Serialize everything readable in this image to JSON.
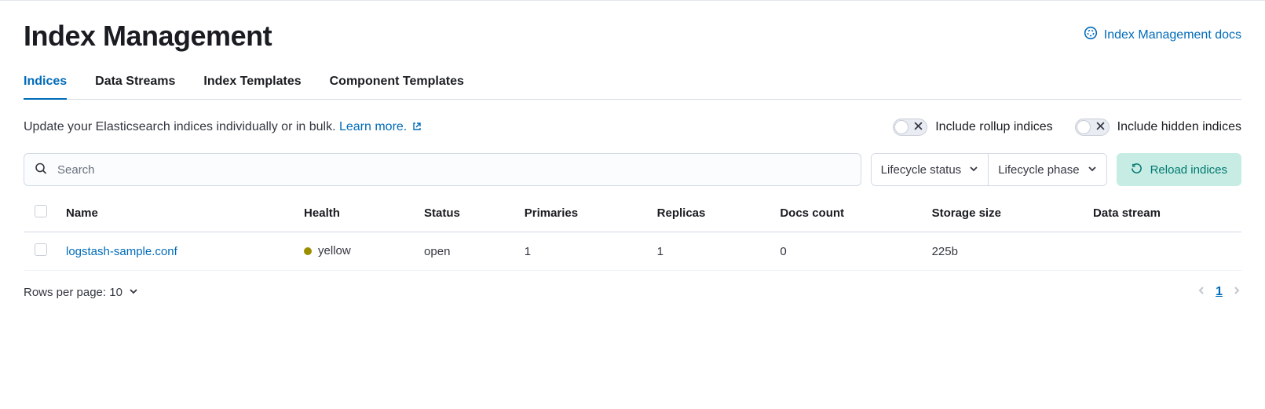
{
  "header": {
    "title": "Index Management",
    "docs_link": "Index Management docs"
  },
  "tabs": [
    {
      "label": "Indices",
      "active": true
    },
    {
      "label": "Data Streams",
      "active": false
    },
    {
      "label": "Index Templates",
      "active": false
    },
    {
      "label": "Component Templates",
      "active": false
    }
  ],
  "subhead": {
    "text": "Update your Elasticsearch indices individually or in bulk. ",
    "learn_more": "Learn more."
  },
  "toggles": {
    "rollup_label": "Include rollup indices",
    "hidden_label": "Include hidden indices"
  },
  "search": {
    "placeholder": "Search"
  },
  "filters": {
    "lifecycle_status": "Lifecycle status",
    "lifecycle_phase": "Lifecycle phase"
  },
  "reload_label": "Reload indices",
  "table": {
    "columns": [
      "Name",
      "Health",
      "Status",
      "Primaries",
      "Replicas",
      "Docs count",
      "Storage size",
      "Data stream"
    ],
    "rows": [
      {
        "name": "logstash-sample.conf",
        "health": "yellow",
        "health_color": "#9b8f00",
        "status": "open",
        "primaries": "1",
        "replicas": "1",
        "docs_count": "0",
        "storage_size": "225b",
        "data_stream": ""
      }
    ]
  },
  "footer": {
    "rows_per_page": "Rows per page: 10",
    "current_page": "1"
  }
}
